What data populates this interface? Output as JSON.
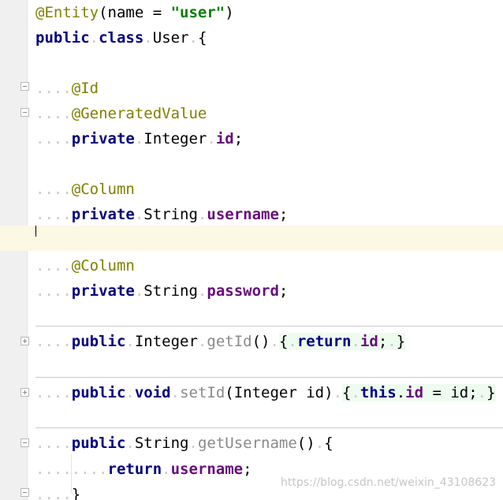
{
  "editor": {
    "lines": [
      {
        "text_a": "@Entity",
        "text_b": "(name = ",
        "text_c": "\"user\"",
        "text_d": ")"
      },
      {
        "kw1": "public",
        "kw2": "class",
        "name": "User",
        "brace": "{"
      },
      {
        "ann": "@Id"
      },
      {
        "ann": "@GeneratedValue"
      },
      {
        "kw": "private",
        "type": "Integer",
        "field": "id",
        "end": ";"
      },
      {
        "ann": "@Column"
      },
      {
        "kw": "private",
        "type": "String",
        "field": "username",
        "end": ";"
      },
      {
        "ann": "@Column"
      },
      {
        "kw": "private",
        "type": "String",
        "field": "password",
        "end": ";"
      },
      {
        "kw": "public",
        "type": "Integer",
        "method": "getId",
        "paren": "()",
        "open": "{",
        "ret": "return",
        "field": "id",
        "end": ";",
        "close": "}"
      },
      {
        "kw1": "public",
        "kw2": "void",
        "method": "setId",
        "params": "(Integer id)",
        "open": "{",
        "this": "this",
        "dot": ".",
        "field": "id",
        "assign": " = id;",
        "close": "}"
      },
      {
        "kw": "public",
        "type": "String",
        "method": "getUsername",
        "paren": "()",
        "brace": "{"
      },
      {
        "ret": "return",
        "field": "username",
        "end": ";"
      },
      {
        "close": "}"
      }
    ],
    "watermark": "https://blog.csdn.net/weixin_43108623",
    "colors": {
      "keyword": "#000080",
      "annotation": "#808000",
      "string": "#008000",
      "field": "#660e7a",
      "method_decl": "#8a8a8a",
      "current_line": "#fbf8e3",
      "gutter": "#f0f0f0"
    },
    "icons": {
      "fold": "minus-box",
      "unfold": "plus-box"
    }
  }
}
